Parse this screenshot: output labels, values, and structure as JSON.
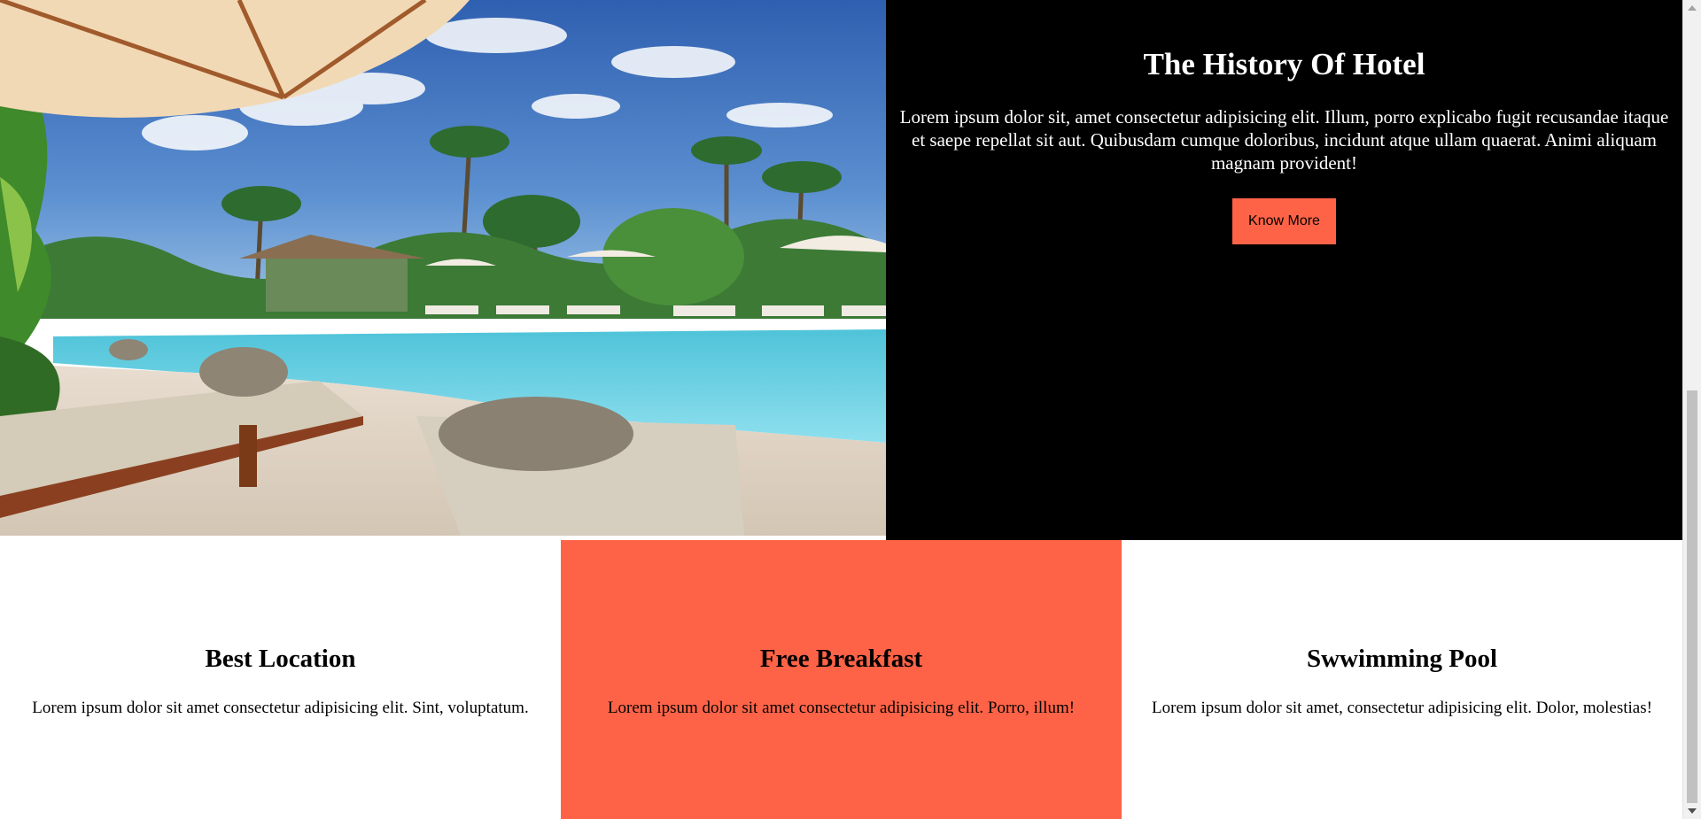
{
  "hero": {
    "image_alt": "Resort pool with sun loungers, rolled towels, umbrellas and palm trees",
    "title": "The History Of Hotel",
    "text": "Lorem ipsum dolor sit, amet consectetur adipisicing elit. Illum, porro explicabo fugit recusandae itaque et saepe repellat sit aut. Quibusdam cumque doloribus, incidunt atque ullam quaerat. Animi aliquam magnam provident!",
    "button_label": "Know More"
  },
  "features": [
    {
      "title": "Best Location",
      "text": "Lorem ipsum dolor sit amet consectetur adipisicing elit. Sint, voluptatum."
    },
    {
      "title": "Free Breakfast",
      "text": "Lorem ipsum dolor sit amet consectetur adipisicing elit. Porro, illum!"
    },
    {
      "title": "Swwimming Pool",
      "text": "Lorem ipsum dolor sit amet, consectetur adipisicing elit. Dolor, molestias!"
    }
  ],
  "colors": {
    "accent": "#ff6347",
    "panel_background": "#000000",
    "panel_text": "#ffffff",
    "page_background": "#ffffff"
  },
  "icons": {
    "scroll_up": "arrow-up-icon",
    "scroll_down": "arrow-down-icon"
  }
}
